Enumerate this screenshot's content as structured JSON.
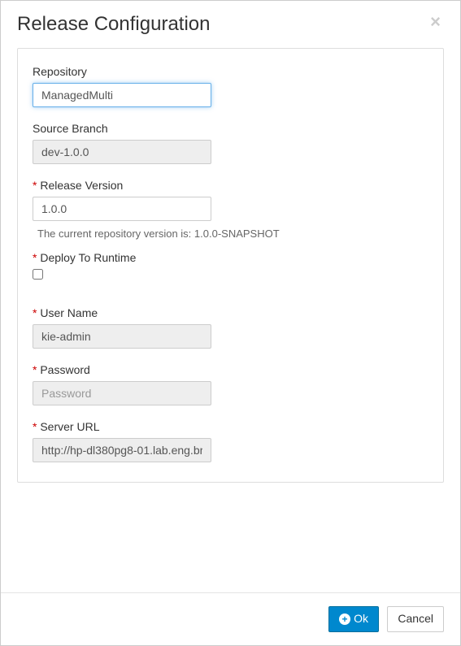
{
  "modal": {
    "title": "Release Configuration"
  },
  "form": {
    "repository": {
      "label": "Repository",
      "value": "ManagedMulti"
    },
    "sourceBranch": {
      "label": "Source Branch",
      "value": "dev-1.0.0"
    },
    "releaseVersion": {
      "label": "Release Version",
      "value": "1.0.0"
    },
    "versionHelp": "The current repository version is: 1.0.0-SNAPSHOT",
    "deployToRuntime": {
      "label": "Deploy To Runtime"
    },
    "userName": {
      "label": "User Name",
      "value": "kie-admin"
    },
    "password": {
      "label": "Password",
      "placeholder": "Password"
    },
    "serverUrl": {
      "label": "Server URL",
      "value": "http://hp-dl380pg8-01.lab.eng.br"
    }
  },
  "footer": {
    "ok": "Ok",
    "cancel": "Cancel"
  }
}
